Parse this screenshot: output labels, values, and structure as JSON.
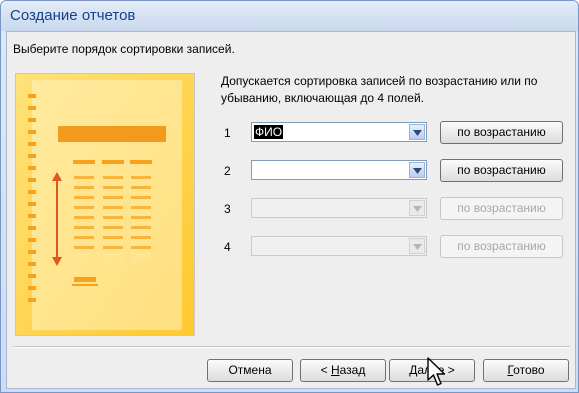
{
  "window": {
    "title": "Создание отчетов"
  },
  "instruction": "Выберите порядок сортировки записей.",
  "description": "Допускается сортировка записей по возрастанию или по убыванию, включающая до 4 полей.",
  "sort_rows": [
    {
      "number": "1",
      "field": "ФИО",
      "order_label": "по возрастанию",
      "enabled": true
    },
    {
      "number": "2",
      "field": "",
      "order_label": "по возрастанию",
      "enabled": true
    },
    {
      "number": "3",
      "field": "",
      "order_label": "по возрастанию",
      "enabled": false
    },
    {
      "number": "4",
      "field": "",
      "order_label": "по возрастанию",
      "enabled": false
    }
  ],
  "buttons": {
    "cancel": "Отмена",
    "back_prefix": "< ",
    "back_key": "Н",
    "back_rest": "азад",
    "next_prefix": "",
    "next_key": "Д",
    "next_rest": "алее >",
    "finish_key": "Г",
    "finish_rest": "отово"
  },
  "colors": {
    "accent": "#15428b",
    "preview_bg": "#ffd04a",
    "preview_accent": "#f39a1e"
  }
}
